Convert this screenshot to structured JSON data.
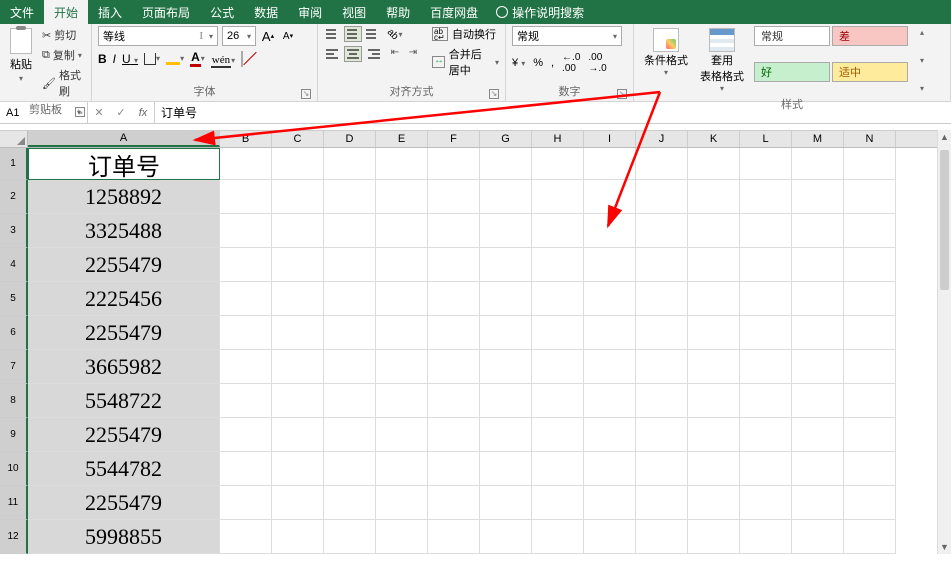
{
  "menu": {
    "tabs": [
      "文件",
      "开始",
      "插入",
      "页面布局",
      "公式",
      "数据",
      "审阅",
      "视图",
      "帮助",
      "百度网盘"
    ],
    "active_index": 1,
    "search_placeholder": "操作说明搜索"
  },
  "ribbon": {
    "clipboard": {
      "paste": "粘贴",
      "cut": "剪切",
      "copy": "复制",
      "format_painter": "格式刷",
      "label": "剪贴板"
    },
    "font": {
      "name": "等线",
      "size": "26",
      "label": "字体",
      "bold": "B",
      "italic": "I",
      "underline": "U",
      "font_color_letter": "A",
      "grow": "A",
      "shrink": "A",
      "wen": "wén"
    },
    "alignment": {
      "wrap": "自动换行",
      "merge": "合并后居中",
      "label": "对齐方式"
    },
    "number": {
      "format": "常规",
      "label": "数字",
      "percent": "%",
      "comma": ",",
      "dec_inc": ".00←",
      "dec_dec": "→.00"
    },
    "styles": {
      "cond": "条件格式",
      "table": "套用\n表格格式",
      "label": "样式",
      "gallery": [
        {
          "text": "常规",
          "bg": "#ffffff",
          "fg": "#333"
        },
        {
          "text": "差",
          "bg": "#f8c7c4",
          "fg": "#9c0006"
        },
        {
          "text": "好",
          "bg": "#c6efce",
          "fg": "#006100"
        },
        {
          "text": "适中",
          "bg": "#ffeb9c",
          "fg": "#9c5700"
        }
      ]
    }
  },
  "namebox": "A1",
  "formula": "订单号",
  "sheet": {
    "columns": [
      "A",
      "B",
      "C",
      "D",
      "E",
      "F",
      "G",
      "H",
      "I",
      "J",
      "K",
      "L",
      "M",
      "N"
    ],
    "selected_col": "A",
    "row_numbers": [
      1,
      2,
      3,
      4,
      5,
      6,
      7,
      8,
      9,
      10,
      11,
      12
    ],
    "colA": [
      "订单号",
      "1258892",
      "3325488",
      "2255479",
      "2225456",
      "2255479",
      "3665982",
      "5548722",
      "2255479",
      "5544782",
      "2255479",
      "5998855"
    ]
  },
  "annotations": {
    "arrows": [
      {
        "from": [
          660,
          92
        ],
        "to": [
          195,
          140
        ]
      },
      {
        "from": [
          660,
          92
        ],
        "to": [
          608,
          226
        ]
      }
    ],
    "color": "#ff0000"
  },
  "chart_data": null
}
